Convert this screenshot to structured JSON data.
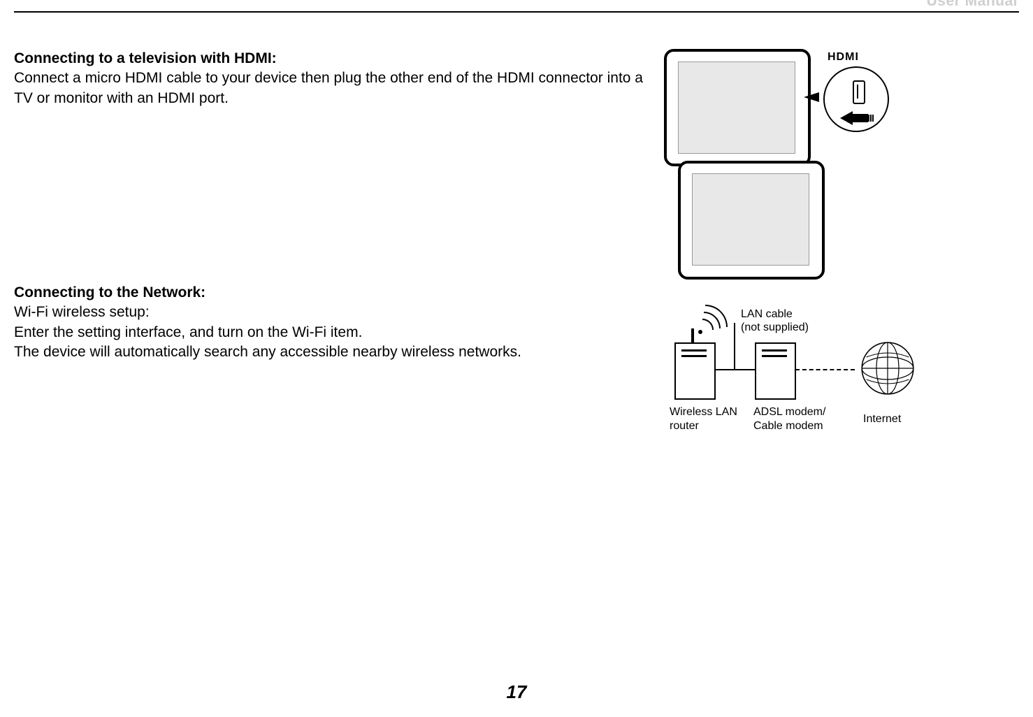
{
  "header": {
    "title": "User Manual"
  },
  "page_number": "17",
  "section1": {
    "heading": "Connecting to a television with HDMI:",
    "body": "Connect a micro HDMI cable to your device then plug the other end of the HDMI connector into a TV or monitor with an HDMI port.",
    "illustration": {
      "logo_text": "HDMI"
    }
  },
  "section2": {
    "heading": "Connecting to the Network:",
    "line1": "Wi-Fi wireless setup:",
    "line2": "Enter the setting interface, and turn on the Wi-Fi item.",
    "line3": "The device will automatically search any accessible nearby wireless networks.",
    "illustration": {
      "lan_label_line1": "LAN cable",
      "lan_label_line2": "(not supplied)",
      "caption_router_line1": "Wireless LAN",
      "caption_router_line2": "router",
      "caption_modem_line1": "ADSL modem/",
      "caption_modem_line2": "Cable modem",
      "caption_internet": "Internet"
    }
  }
}
